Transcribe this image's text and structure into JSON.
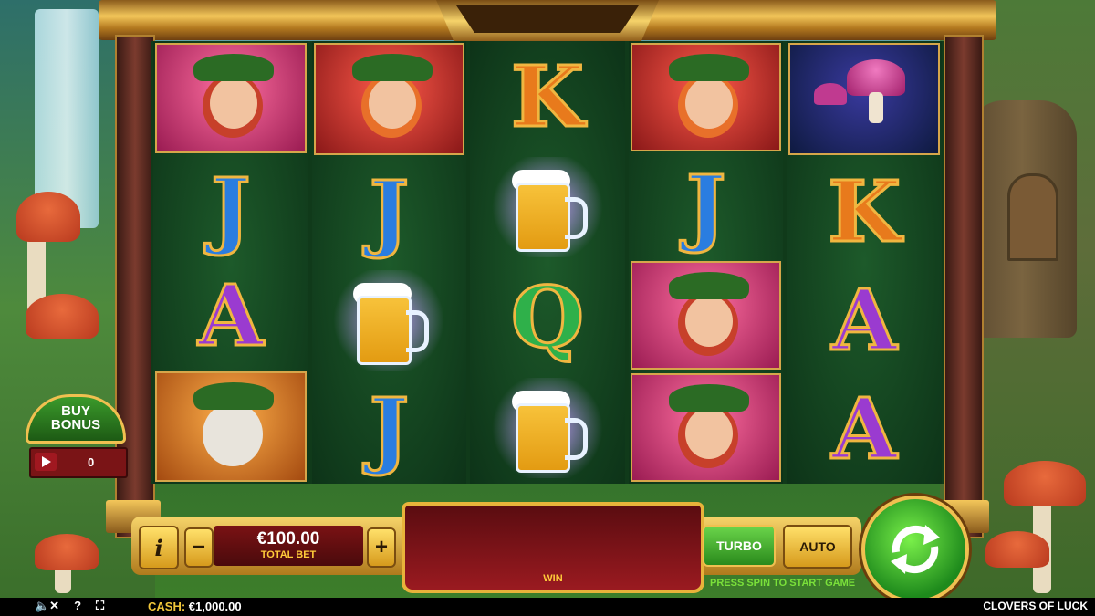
{
  "game_title": "CLOVERS OF LUCK",
  "reels": [
    [
      "lady",
      "J",
      "A",
      "rabbit"
    ],
    [
      "leprechaun",
      "J",
      "beer",
      "J"
    ],
    [
      "K",
      "beer",
      "Q",
      "beer"
    ],
    [
      "leprechaun",
      "J",
      "lady",
      "lady"
    ],
    [
      "mushroom",
      "K",
      "A",
      "A"
    ]
  ],
  "buy_bonus": {
    "label_line1": "BUY",
    "label_line2": "BONUS",
    "count": "0"
  },
  "controls": {
    "info_label": "i",
    "minus_label": "−",
    "plus_label": "+",
    "bet_value": "€100.00",
    "bet_label": "TOTAL BET",
    "win_label": "WIN",
    "turbo_label": "TURBO",
    "auto_label": "AUTO",
    "press_spin_text": "PRESS SPIN TO START GAME"
  },
  "footer": {
    "cash_label": "CASH:",
    "cash_value": "€1,000.00",
    "sound_icon": "speaker-muted-icon",
    "help_icon": "question-icon",
    "fullscreen_icon": "fullscreen-icon"
  },
  "colors": {
    "accent_gold": "#f0c050",
    "spin_green": "#2fb04a",
    "win_red": "#9a1a20"
  }
}
